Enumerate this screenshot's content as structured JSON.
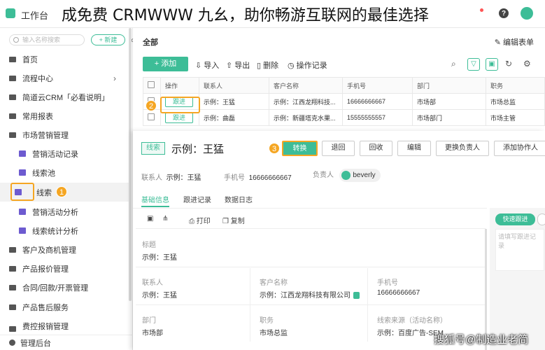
{
  "header": {
    "app_title": "工作台",
    "banner": "成免费 CRMWWW 九幺，助你畅游互联网的最佳选择",
    "help_icon": "?"
  },
  "sidebar": {
    "search_placeholder": "输入名称搜索",
    "new_button": "+ 新建",
    "collapse_icon": "«",
    "items": [
      {
        "label": "首页",
        "icon": "home-icon"
      },
      {
        "label": "流程中心",
        "icon": "flow-icon",
        "chevron": "›"
      },
      {
        "label": "简道云CRM「必看说明」",
        "icon": "doc-icon"
      },
      {
        "label": "常用报表",
        "icon": "folder-icon"
      },
      {
        "label": "市场营销管理",
        "icon": "folder-icon"
      },
      {
        "label": "营销活动记录",
        "icon": "form-icon"
      },
      {
        "label": "线索池",
        "icon": "form-icon"
      },
      {
        "label": "线索",
        "icon": "leads-icon"
      },
      {
        "label": "营销活动分析",
        "icon": "chart-icon"
      },
      {
        "label": "线索统计分析",
        "icon": "chart-icon"
      },
      {
        "label": "客户及商机管理",
        "icon": "folder-icon"
      },
      {
        "label": "产品报价管理",
        "icon": "folder-icon"
      },
      {
        "label": "合同/回款/开票管理",
        "icon": "folder-icon"
      },
      {
        "label": "产品售后服务",
        "icon": "folder-icon"
      },
      {
        "label": "费控报销管理",
        "icon": "folder-icon"
      }
    ],
    "admin": "管理后台",
    "step_badge": "1"
  },
  "main": {
    "tab": "全部",
    "edit_form": "编辑表单",
    "add_button": "+ 添加",
    "toolbar": [
      "导入",
      "导出",
      "删除",
      "操作记录"
    ],
    "columns": [
      "操作",
      "联系人",
      "客户名称",
      "手机号",
      "部门",
      "职务"
    ],
    "rows": [
      {
        "action": "跟进",
        "contact": "示例：王猛",
        "customer": "示例：江西龙翔科技...",
        "phone": "16666666667",
        "dept": "市场部",
        "title": "市场总监"
      },
      {
        "action": "跟进",
        "contact": "示例：曲磊",
        "customer": "示例：新疆塔克水果...",
        "phone": "15555555557",
        "dept": "市场部门",
        "title": "市场主管"
      }
    ],
    "step_badge": "2"
  },
  "detail": {
    "tag": "线索",
    "title": "示例：王猛",
    "step_badge": "3",
    "buttons": [
      "转换",
      "退回",
      "回收",
      "编辑",
      "更换负责人",
      "添加协作人"
    ],
    "meta": {
      "contact_label": "联系人",
      "contact_value": "示例：王猛",
      "phone_label": "手机号",
      "phone_value": "16666666667",
      "owner_label": "负责人",
      "owner_value": "beverly"
    },
    "tabs": [
      "基础信息",
      "跟进记录",
      "数据日志"
    ],
    "subtools": [
      "打印",
      "复制"
    ],
    "fields": {
      "title_label": "标题",
      "title_value": "示例：王猛",
      "contact_label": "联系人",
      "contact_value": "示例：王猛",
      "customer_label": "客户名称",
      "customer_value": "示例：江西龙翔科技有限公司",
      "phone_label": "手机号",
      "phone_value": "16666666667",
      "dept_label": "部门",
      "dept_value": "市场部",
      "job_label": "职务",
      "job_value": "市场总监",
      "source_label": "线索来源（活动名称）",
      "source_value": "示例：百度广告-SEM"
    },
    "quick_follow": "快速跟进",
    "note_placeholder": "请填写跟进记录"
  },
  "watermark": "搜狐号@制造业老简",
  "colors": {
    "accent": "#3dbd97",
    "highlight": "#f5a623"
  }
}
